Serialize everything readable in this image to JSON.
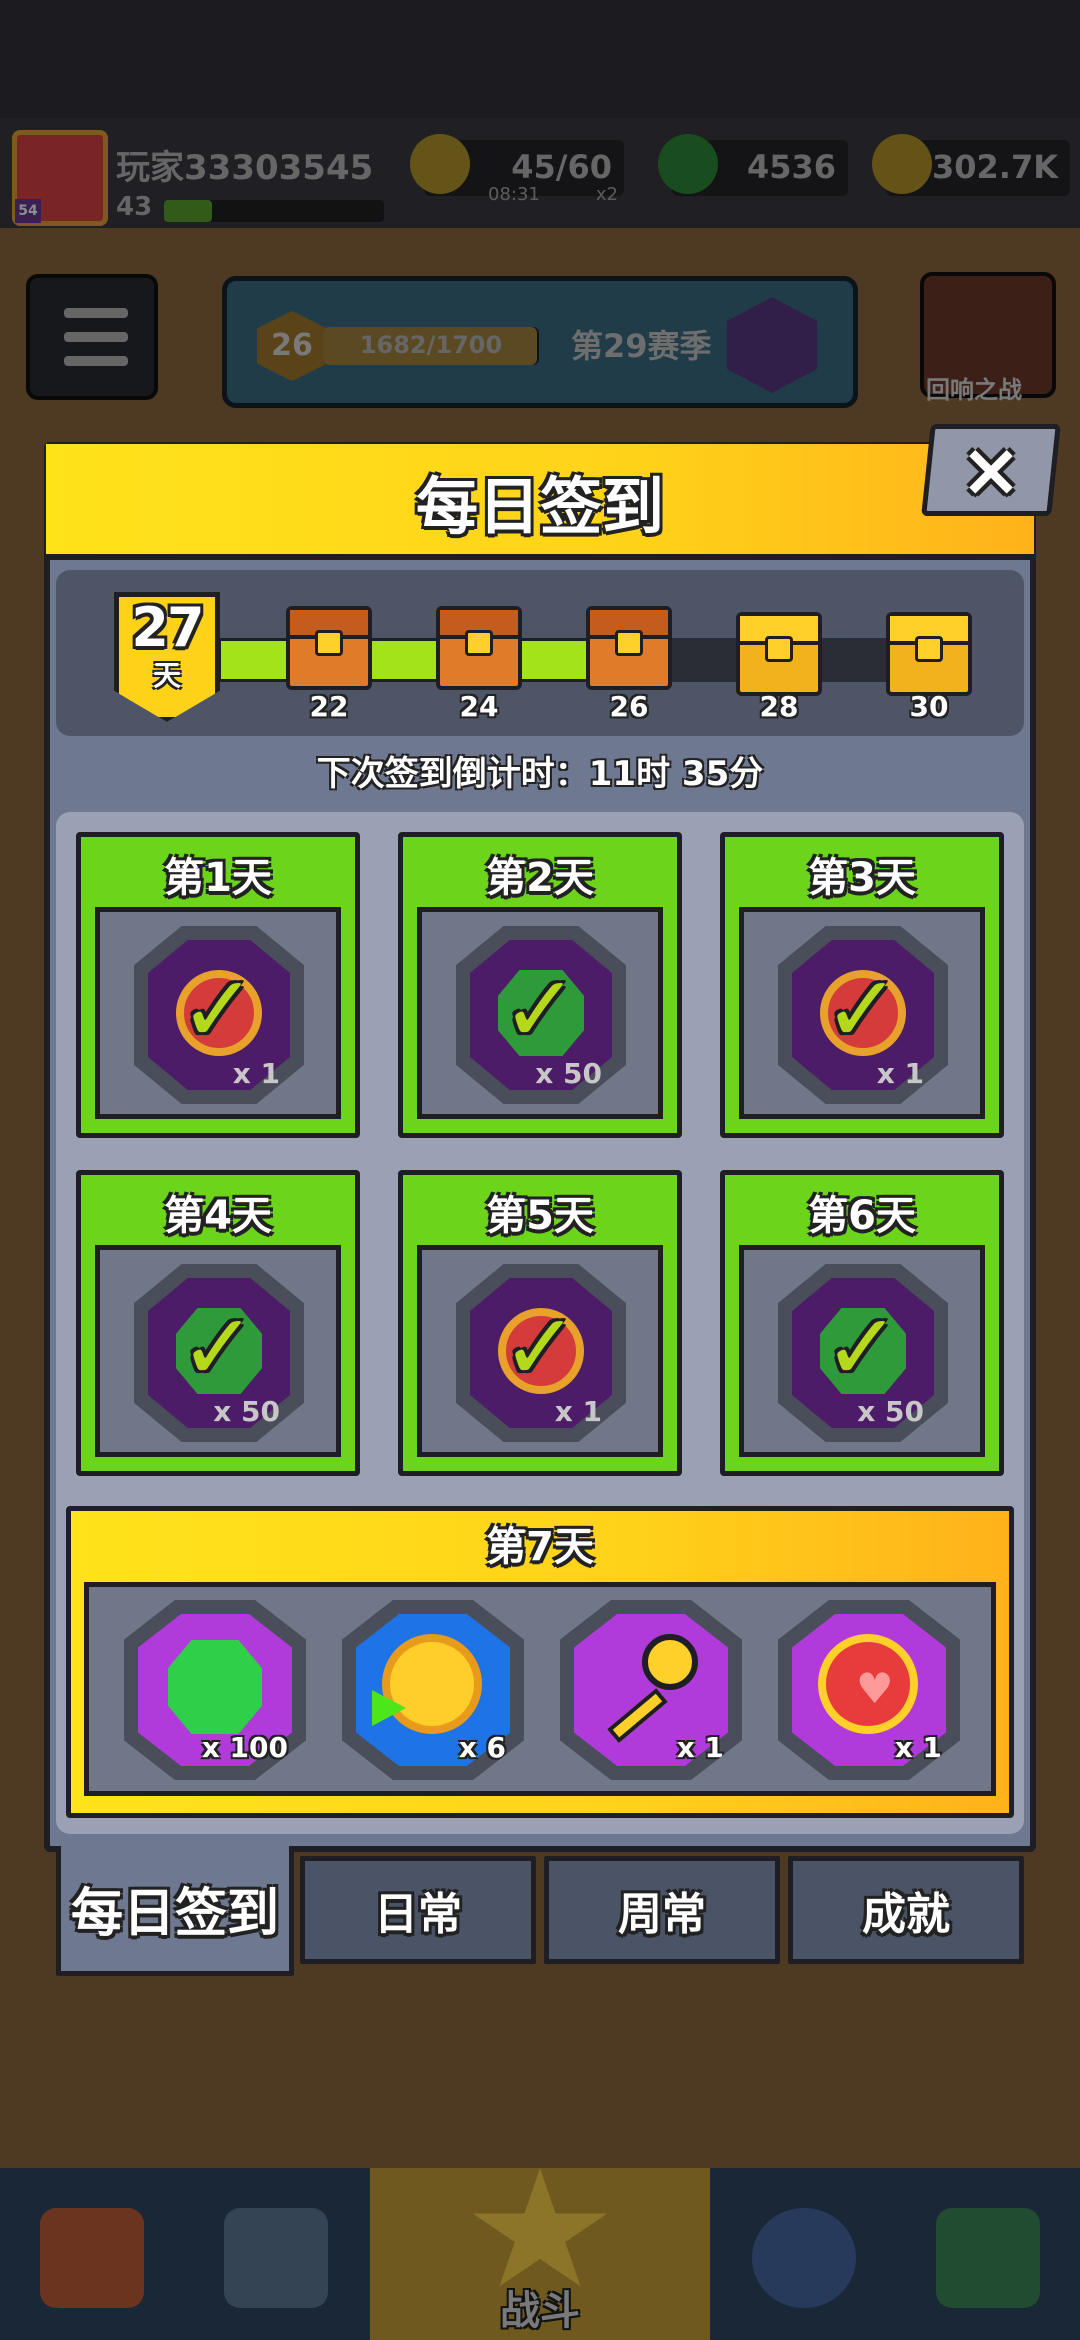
{
  "player": {
    "name": "玩家33303545",
    "level": "43",
    "avatar_badge": "54"
  },
  "resources": {
    "energy": {
      "value": "45/60",
      "timer": "08:31",
      "multiplier": "x2"
    },
    "gems": {
      "value": "4536"
    },
    "coins": {
      "value": "302.7K"
    }
  },
  "season": {
    "rank": "26",
    "progress": "1682/1700",
    "name": "第29赛季"
  },
  "echo_battle": {
    "label": "回响之战"
  },
  "dialog": {
    "title": "每日签到",
    "close_label": "×",
    "streak": {
      "days": "27",
      "unit": "天",
      "progress_fraction": 0.52
    },
    "milestones": [
      {
        "day": "22",
        "state": "opened"
      },
      {
        "day": "24",
        "state": "opened"
      },
      {
        "day": "26",
        "state": "opened"
      },
      {
        "day": "28",
        "state": "locked"
      },
      {
        "day": "30",
        "state": "locked"
      }
    ],
    "countdown": "下次签到倒计时：11时 35分",
    "days": [
      {
        "title": "第1天",
        "item": "coin",
        "qty": "x 1",
        "claimed": true
      },
      {
        "title": "第2天",
        "item": "gem",
        "qty": "x 50",
        "claimed": true
      },
      {
        "title": "第3天",
        "item": "coin",
        "qty": "x 1",
        "claimed": true
      },
      {
        "title": "第4天",
        "item": "gem",
        "qty": "x 50",
        "claimed": true
      },
      {
        "title": "第5天",
        "item": "coin",
        "qty": "x 1",
        "claimed": true
      },
      {
        "title": "第6天",
        "item": "gem",
        "qty": "x 50",
        "claimed": true
      }
    ],
    "day7": {
      "title": "第7天",
      "rewards": [
        {
          "item": "gem-icon",
          "qty": "x 100"
        },
        {
          "item": "coin-speed-icon",
          "qty": "x 6"
        },
        {
          "item": "key-icon",
          "qty": "x 1"
        },
        {
          "item": "heart-coin-icon",
          "qty": "x 1"
        }
      ]
    },
    "tabs": [
      "每日签到",
      "日常",
      "周常",
      "成就"
    ]
  },
  "nav": {
    "battle_label": "战斗"
  }
}
